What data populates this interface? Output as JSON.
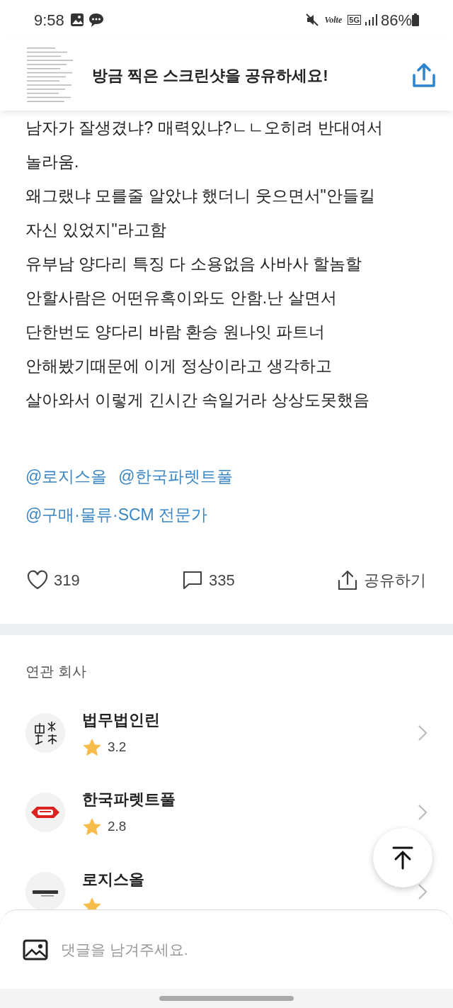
{
  "status_bar": {
    "time": "9:58",
    "volte": "Volte",
    "network": "5G",
    "battery": "86%"
  },
  "share_banner": {
    "text": "방금 찍은 스크린샷을 공유하세요!"
  },
  "post": {
    "lines": [
      "남자가 잘생겼냐? 매력있냐?ㄴㄴ오히려 반대여서",
      "놀라움.",
      "왜그랬냐 모를줄 알았냐 했더니 웃으면서\"안들킬",
      "자신 있었지\"라고함",
      "유부남 양다리 특징 다 소용없음 사바사 할놈할",
      "안할사람은 어떤유혹이와도 안함.난 살면서",
      "단한번도 양다리 바람 환승 원나잇 파트너",
      "안해봤기때문에 이게 정상이라고 생각하고",
      "살아와서 이렇게 긴시간 속일거라 상상도못했음"
    ],
    "mentions": [
      [
        "@로지스올",
        "@한국파렛트풀"
      ],
      [
        "@구매·물류·SCM 전문가"
      ]
    ],
    "actions": [
      {
        "kind": "like",
        "label": "319"
      },
      {
        "kind": "comment",
        "label": "335"
      },
      {
        "kind": "share",
        "label": "공유하기"
      }
    ]
  },
  "related": {
    "title": "연관 회사",
    "companies": [
      {
        "name": "법무법인린",
        "rating": "3.2",
        "kind": "hanzi"
      },
      {
        "name": "한국파렛트풀",
        "rating": "2.8",
        "kind": "kpp"
      },
      {
        "name": "로지스올",
        "kind": "logis"
      }
    ]
  },
  "comment_bar": {
    "placeholder": "댓글을 남겨주세요."
  }
}
